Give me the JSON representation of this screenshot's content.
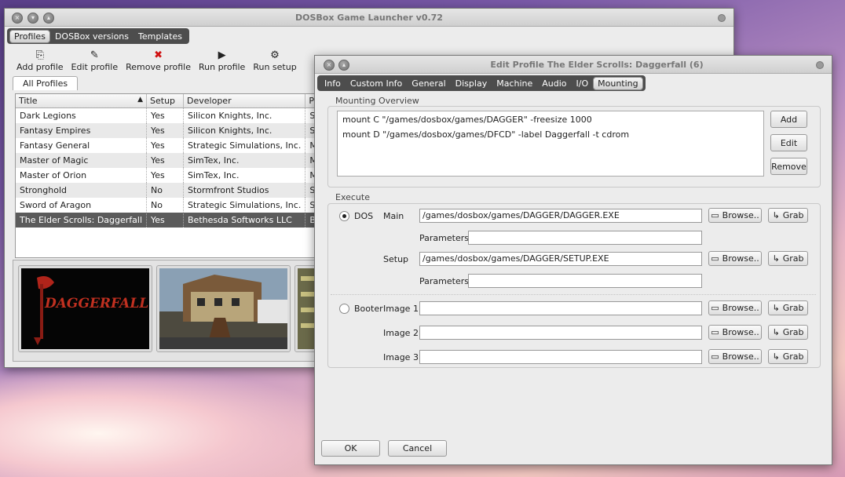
{
  "main_window": {
    "title": "DOSBox Game Launcher v0.72",
    "tabs": [
      {
        "label": "Profiles"
      },
      {
        "label": "DOSBox versions"
      },
      {
        "label": "Templates"
      }
    ],
    "toolbar": [
      {
        "label": "Add profile",
        "icon": "add-profile-icon"
      },
      {
        "label": "Edit profile",
        "icon": "edit-profile-icon"
      },
      {
        "label": "Remove profile",
        "icon": "remove-profile-icon"
      },
      {
        "label": "Run profile",
        "icon": "run-profile-icon"
      },
      {
        "label": "Run setup",
        "icon": "run-setup-icon"
      }
    ],
    "filter_tab": "All Profiles",
    "columns": [
      "Title",
      "Setup",
      "Developer",
      "Publish"
    ],
    "rows": [
      {
        "title": "Dark Legions",
        "setup": "Yes",
        "developer": "Silicon Knights, Inc.",
        "publisher": "Strate"
      },
      {
        "title": "Fantasy Empires",
        "setup": "Yes",
        "developer": "Silicon Knights, Inc.",
        "publisher": "Strate"
      },
      {
        "title": "Fantasy General",
        "setup": "Yes",
        "developer": "Strategic Simulations, Inc.",
        "publisher": "Mindsc"
      },
      {
        "title": "Master of Magic",
        "setup": "Yes",
        "developer": "SimTex, Inc.",
        "publisher": "MicroP"
      },
      {
        "title": "Master of Orion",
        "setup": "Yes",
        "developer": "SimTex, Inc.",
        "publisher": "MicroP"
      },
      {
        "title": "Stronghold",
        "setup": "No",
        "developer": "Stormfront Studios",
        "publisher": "Softgo"
      },
      {
        "title": "Sword of Aragon",
        "setup": "No",
        "developer": "Strategic Simulations, Inc.",
        "publisher": "Strate"
      },
      {
        "title": "The Elder Scrolls: Daggerfall",
        "setup": "Yes",
        "developer": "Bethesda Softworks LLC",
        "publisher": "Bethes"
      }
    ],
    "logo_text": "DAGGERFALL"
  },
  "dialog": {
    "title": "Edit Profile The Elder Scrolls: Daggerfall (6)",
    "tabs": [
      {
        "label": "Info"
      },
      {
        "label": "Custom Info"
      },
      {
        "label": "General"
      },
      {
        "label": "Display"
      },
      {
        "label": "Machine"
      },
      {
        "label": "Audio"
      },
      {
        "label": "I/O"
      },
      {
        "label": "Mounting"
      }
    ],
    "mounting_overview": {
      "title": "Mounting Overview",
      "lines": [
        "mount C \"/games/dosbox/games/DAGGER\" -freesize 1000",
        "mount D \"/games/dosbox/games/DFCD\" -label Daggerfall -t cdrom"
      ],
      "add": "Add",
      "edit": "Edit",
      "remove": "Remove"
    },
    "execute": {
      "title": "Execute",
      "dos_label": "DOS",
      "booter_label": "Booter",
      "main_label": "Main",
      "main_value": "/games/dosbox/games/DAGGER/DAGGER.EXE",
      "parameters_label": "Parameters",
      "setup_label": "Setup",
      "setup_value": "/games/dosbox/games/DAGGER/SETUP.EXE",
      "image1_label": "Image 1",
      "image2_label": "Image 2",
      "image3_label": "Image 3",
      "browse": "Browse..",
      "grab": "Grab"
    },
    "ok": "OK",
    "cancel": "Cancel"
  }
}
